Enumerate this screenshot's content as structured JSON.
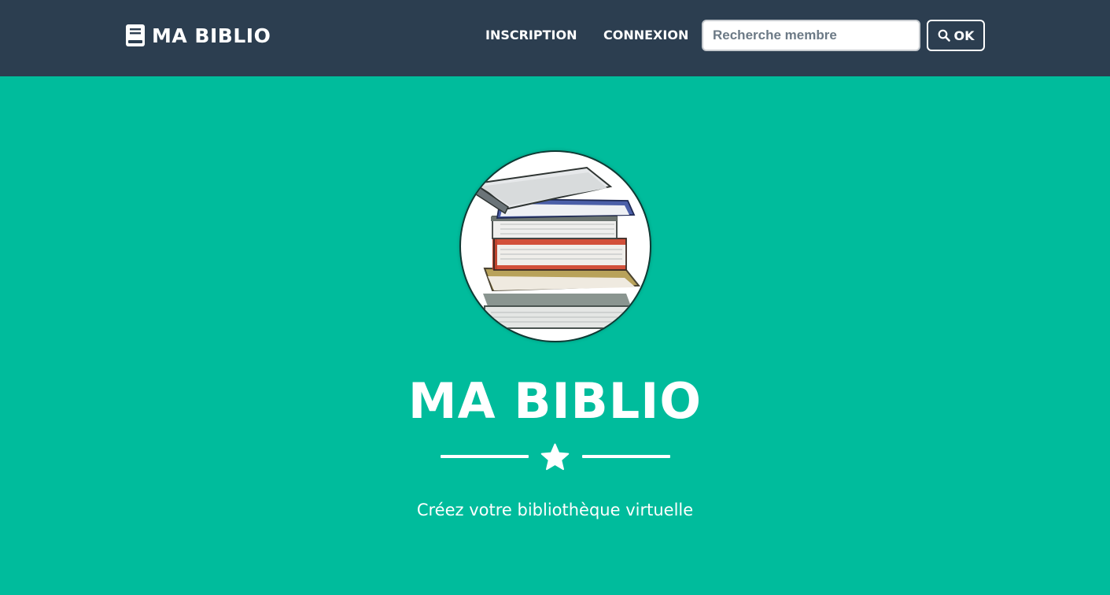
{
  "navbar": {
    "brand": {
      "label": "MA BIBLIO",
      "icon": "book-icon"
    },
    "links": [
      {
        "label": "INSCRIPTION"
      },
      {
        "label": "CONNEXION"
      }
    ],
    "search": {
      "placeholder": "Recherche membre",
      "value": "",
      "button_label": "OK",
      "button_icon": "search-icon"
    }
  },
  "hero": {
    "image": "stack-of-books",
    "title": "MA BIBLIO",
    "divider_icon": "star-icon",
    "subtitle": "Créez votre bibliothèque virtuelle"
  },
  "colors": {
    "navbar_bg": "#2c3e50",
    "hero_bg": "#00bc9c",
    "text": "#ffffff"
  }
}
